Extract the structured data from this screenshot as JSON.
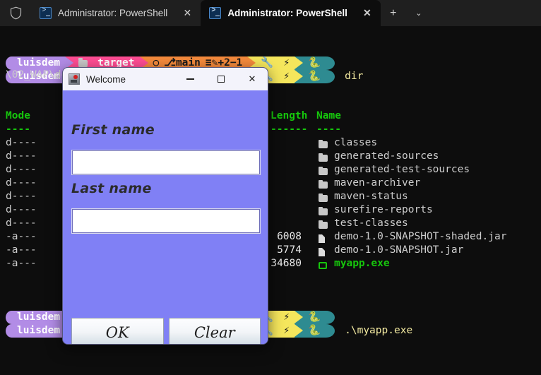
{
  "titlebar": {
    "shield_icon": "shield-icon",
    "tabs": [
      {
        "icon": "powershell-icon",
        "label": "Administrator: PowerShell",
        "close_label": "✕",
        "active": false
      },
      {
        "icon": "powershell-icon",
        "label": "Administrator: PowerShell",
        "close_label": "✕",
        "active": true
      }
    ],
    "new_tab_label": "+",
    "dropdown_label": "⌄"
  },
  "terminal": {
    "prompt": {
      "user": "luisdem",
      "folder_icon": "folder-icon",
      "dir": "target",
      "git_icon": "github-icon",
      "branch_glyph": "⎇",
      "branch": "main",
      "status_glyph": "≡",
      "edit_glyph": "✎",
      "staged": "+2",
      "removed": "−1",
      "tool_glyph": "🔧",
      "bolt_glyph": "⚡",
      "python_glyph": "🐍"
    },
    "commands": {
      "dir": "dir",
      "run_exe": ".\\myapp.exe"
    },
    "path_line": "\\02_WAP\\demo\\target",
    "headers": {
      "mode": "Mode",
      "length": "Length",
      "name": "Name",
      "mode_rule": "----",
      "length_rule": "------",
      "name_rule": "----"
    },
    "listing": [
      {
        "mode": "d----",
        "length": "",
        "icon": "folder-icon",
        "name": "classes",
        "kind": "dir"
      },
      {
        "mode": "d----",
        "length": "",
        "icon": "folder-icon",
        "name": "generated-sources",
        "kind": "dir"
      },
      {
        "mode": "d----",
        "length": "",
        "icon": "folder-icon",
        "name": "generated-test-sources",
        "kind": "dir"
      },
      {
        "mode": "d----",
        "length": "",
        "icon": "folder-icon",
        "name": "maven-archiver",
        "kind": "dir"
      },
      {
        "mode": "d----",
        "length": "",
        "icon": "folder-icon",
        "name": "maven-status",
        "kind": "dir"
      },
      {
        "mode": "d----",
        "length": "",
        "icon": "folder-icon",
        "name": "surefire-reports",
        "kind": "dir"
      },
      {
        "mode": "d----",
        "length": "",
        "icon": "folder-icon",
        "name": "test-classes",
        "kind": "dir"
      },
      {
        "mode": "-a---",
        "length": "6008",
        "icon": "file-icon",
        "name": "demo-1.0-SNAPSHOT-shaded.jar",
        "kind": "file"
      },
      {
        "mode": "-a---",
        "length": "5774",
        "icon": "file-icon",
        "name": "demo-1.0-SNAPSHOT.jar",
        "kind": "file"
      },
      {
        "mode": "-a---",
        "length": "34680",
        "icon": "executable-icon",
        "name": "myapp.exe",
        "kind": "exe"
      }
    ]
  },
  "dialog": {
    "title": "Welcome",
    "app_icon": "java-duke-icon",
    "minimize_label": "—",
    "maximize_label": "□",
    "close_label": "✕",
    "fields": [
      {
        "label": "First name",
        "value": "",
        "placeholder": ""
      },
      {
        "label": "Last name",
        "value": "",
        "placeholder": ""
      }
    ],
    "buttons": [
      {
        "label": "OK"
      },
      {
        "label": "Clear"
      }
    ]
  },
  "colors": {
    "terminal_bg": "#0d0d0d",
    "titlebar_bg": "#1f1f1f",
    "dialog_bg": "#8080f5",
    "prompt_user": "#b28ce6",
    "prompt_dir": "#ff4d94",
    "prompt_git": "#f58a3c",
    "prompt_tool": "#f5e65c",
    "prompt_python": "#2e8b91",
    "header_green": "#16c60c",
    "command_yellow": "#f2e9a0"
  }
}
